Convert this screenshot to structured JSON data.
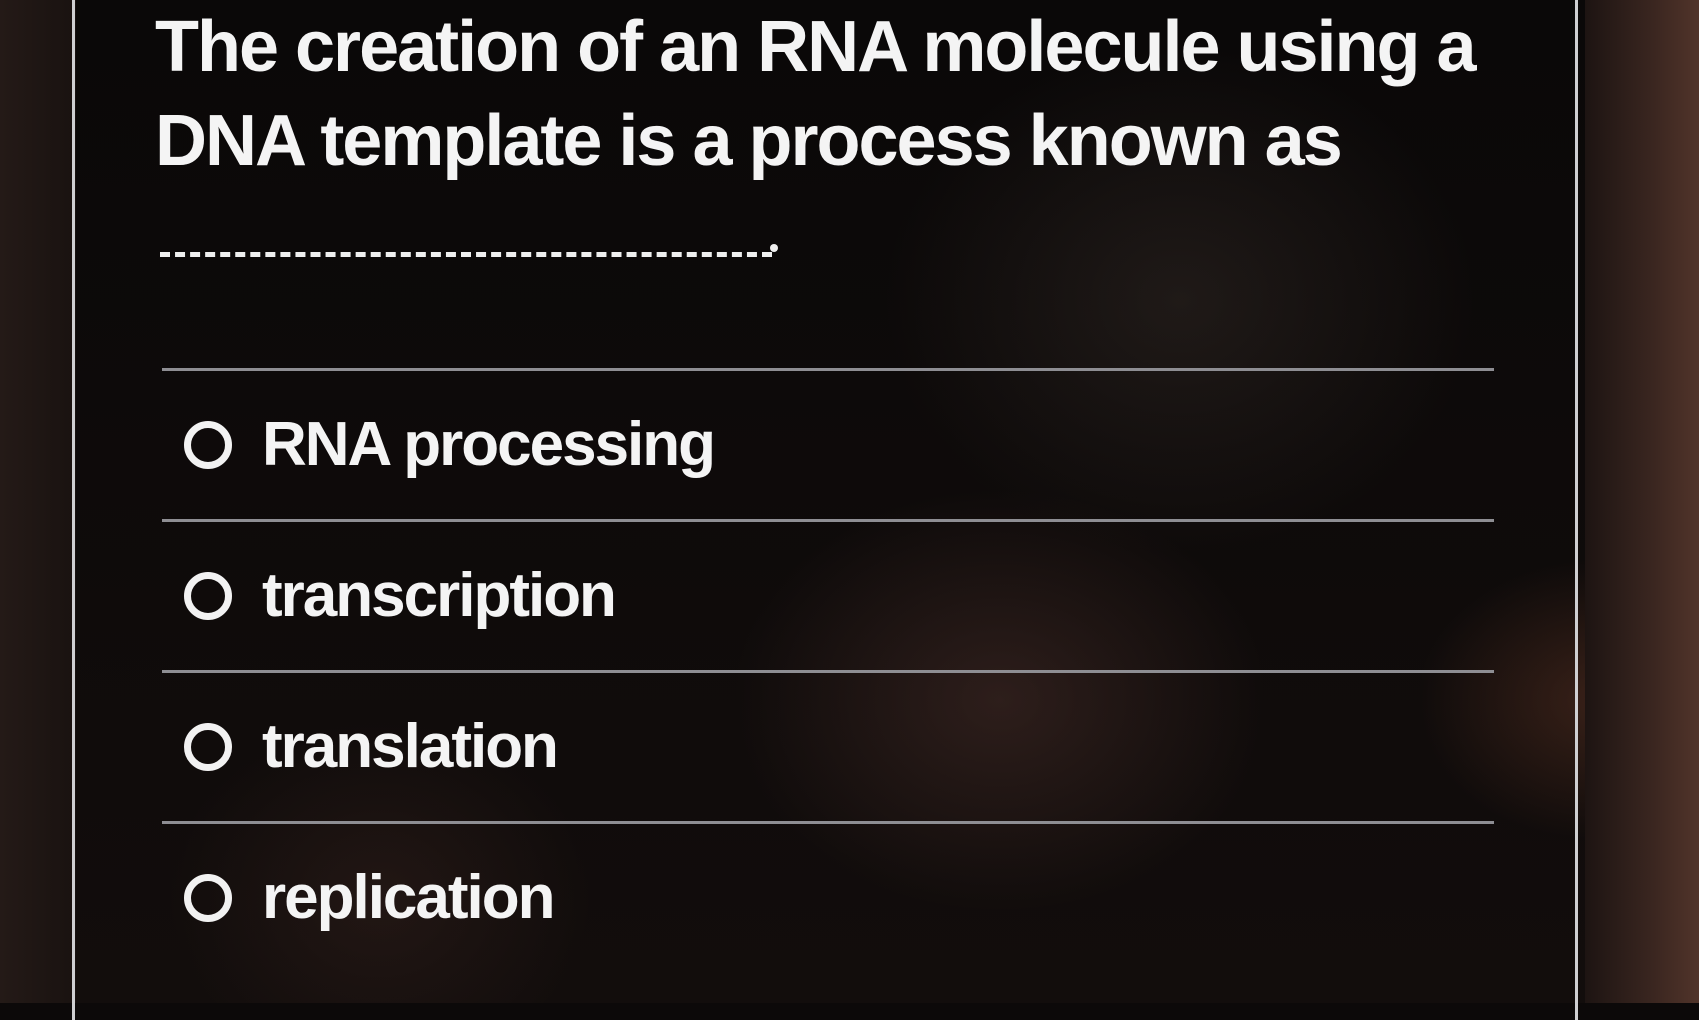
{
  "question": {
    "prompt": "The creation of an RNA molecule using a DNA template is a process known as",
    "blank_suffix": "."
  },
  "options": [
    {
      "label": "RNA processing",
      "selected": false
    },
    {
      "label": "transcription",
      "selected": false
    },
    {
      "label": "translation",
      "selected": false
    },
    {
      "label": "replication",
      "selected": false
    }
  ],
  "colors": {
    "background": "#0c0909",
    "text": "#f4f4f4",
    "divider": "#8e8e93",
    "card_border": "#cfcfd2"
  }
}
